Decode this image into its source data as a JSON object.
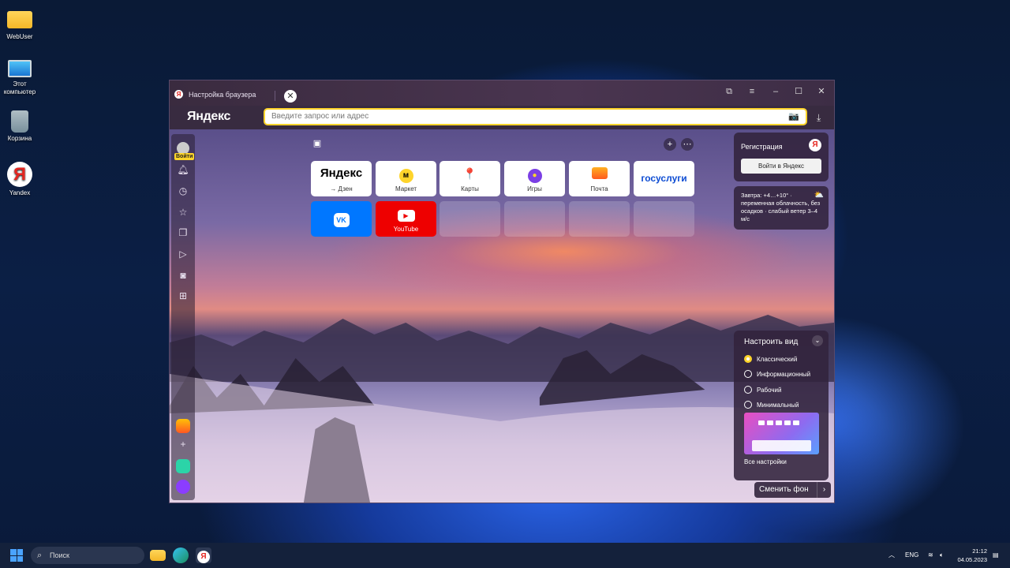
{
  "desktop": {
    "icons": [
      {
        "label": "WebUser",
        "icon": "folder-icon"
      },
      {
        "label": "Этот компьютер",
        "icon": "computer-icon"
      },
      {
        "label": "Корзина",
        "icon": "recycle-bin-icon"
      },
      {
        "label": "Yandex",
        "icon": "yandex-browser-icon"
      }
    ]
  },
  "browser": {
    "tab_title": "Настройка браузера",
    "logo": "Яндекс",
    "search_placeholder": "Введите запрос или адрес",
    "sidebar": {
      "login_label": "Войти"
    },
    "tiles": [
      {
        "label": "→ Дзен",
        "title": "Яндекс"
      },
      {
        "label": "Маркет"
      },
      {
        "label": "Карты"
      },
      {
        "label": "Игры"
      },
      {
        "label": "Почта"
      },
      {
        "title": "госуслуги"
      },
      {
        "title": "VK"
      },
      {
        "label": "YouTube"
      }
    ],
    "registration": {
      "title": "Регистрация",
      "button": "Войти в Яндекс"
    },
    "weather": {
      "text": "Завтра: +4…+10° · переменная облачность, без осадков · слабый ветер 3–4 м/с"
    },
    "view_panel": {
      "title": "Настроить вид",
      "options": [
        "Классический",
        "Информационный",
        "Рабочий",
        "Минимальный"
      ],
      "selected": "Классический",
      "all_settings": "Все настройки"
    },
    "change_bg": "Сменить фон"
  },
  "taskbar": {
    "search_placeholder": "Поиск",
    "lang": "ENG",
    "time": "21:12",
    "date": "04.05.2023"
  },
  "colors": {
    "accent_yellow": "#fed42b",
    "yandex_red": "#e52620",
    "vk_blue": "#0077ff",
    "youtube_red": "#ff0000"
  }
}
